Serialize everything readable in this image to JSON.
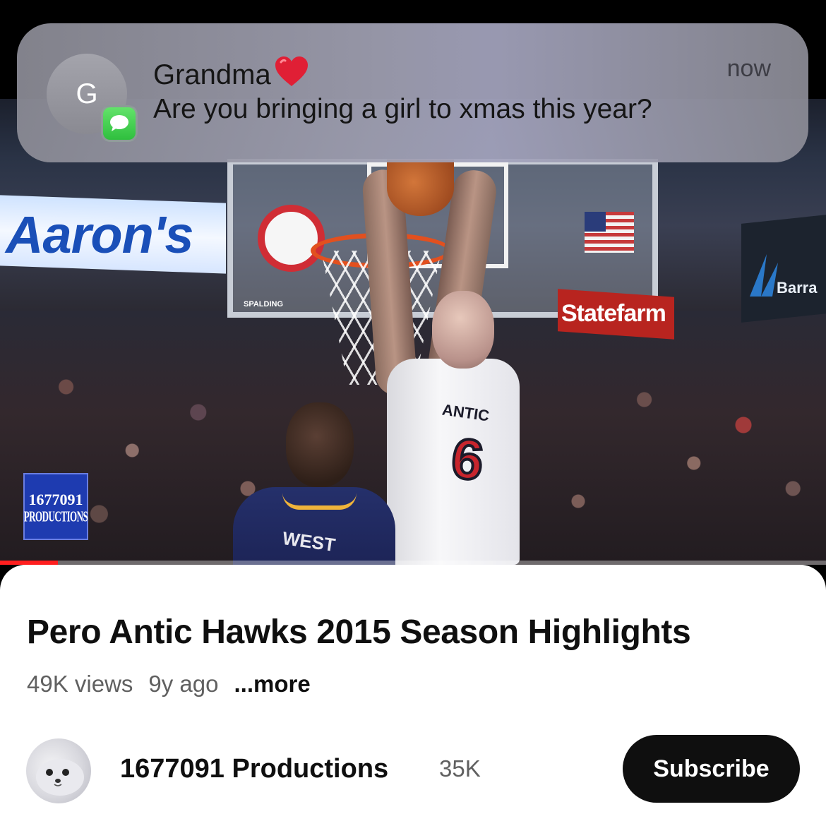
{
  "notification": {
    "avatar_initial": "G",
    "app_icon": "messages-icon",
    "sender": "Grandma",
    "sender_emoji": "heart-icon",
    "time": "now",
    "message": "Are you bringing a girl to xmas this year?"
  },
  "video": {
    "scene": {
      "banner_left": "Aaron's",
      "banner_right": "Barra",
      "sponsor": "Statefarm",
      "backboard_brand": "SPALDING",
      "player_name": "ANTIC",
      "player_number": "6",
      "defender_name": "WEST"
    },
    "watermark": {
      "number": "1677091",
      "label": "PRODUCTIONS"
    },
    "progress": 0.07,
    "colors": {
      "progress": "#ff1f1f"
    }
  },
  "details": {
    "title": "Pero Antic Hawks 2015 Season Highlights",
    "views": "49K views",
    "age": "9y ago",
    "more_label": "...more"
  },
  "channel": {
    "avatar": "seal-avatar",
    "name": "1677091 Productions",
    "subscribers": "35K",
    "subscribe_label": "Subscribe"
  }
}
